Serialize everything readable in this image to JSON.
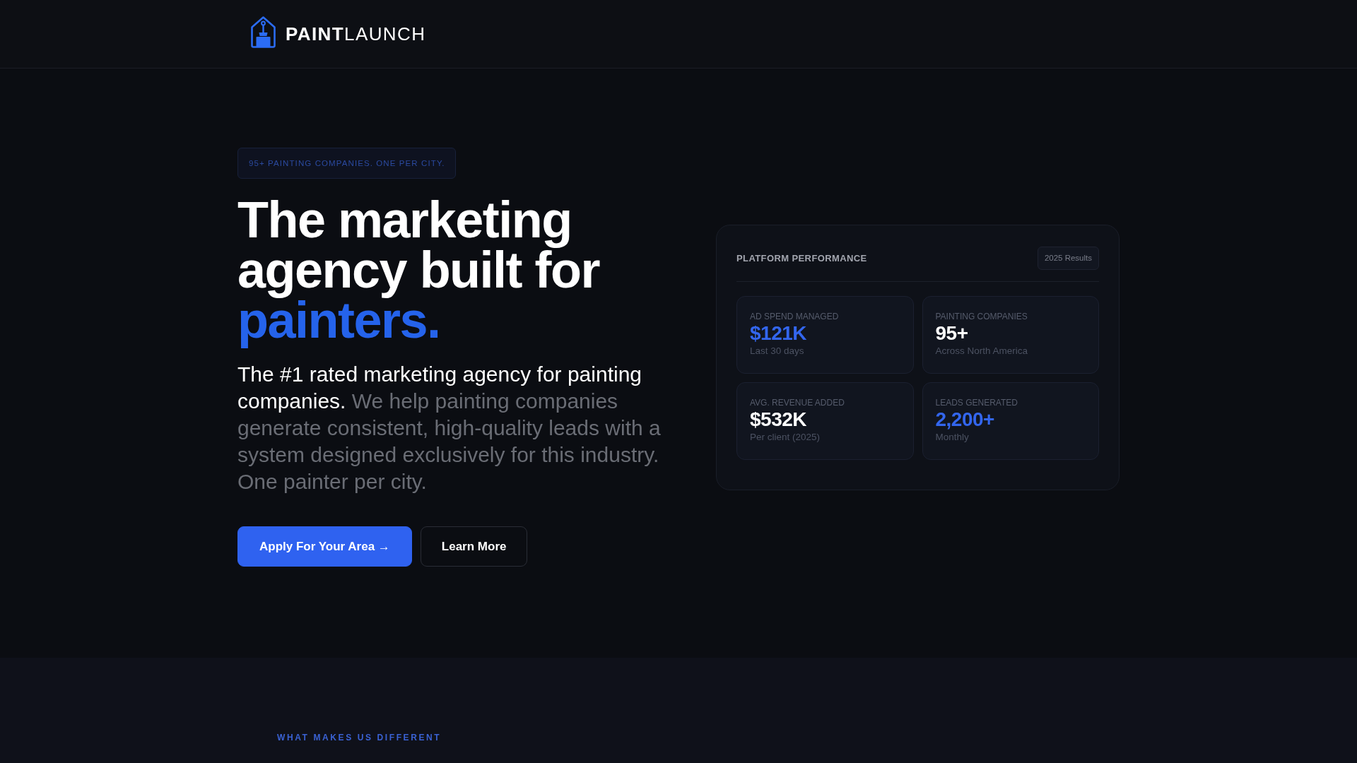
{
  "header": {
    "logo": "**PAINT**LAUNCH"
  },
  "hero": {
    "badge": "95+ PAINTING COMPANIES. ONE PER CITY.",
    "headline": "The marketing agency built for",
    "headline_highlight": "painters.",
    "description": "**The #1 rated marketing agency for painting companies.** We help painting companies generate consistent, high-quality leads with a system designed exclusively for this industry. One painter per city.",
    "buttons": [
      {
        "label": "Apply For Your Area →",
        "kind": "primary"
      },
      {
        "label": "Learn More",
        "kind": "secondary"
      }
    ]
  },
  "performance_card": {
    "title": "PLATFORM PERFORMANCE",
    "badge": "2025 Results",
    "stats": [
      {
        "label": "AD SPEND MANAGED",
        "value": "$121K",
        "note": "Last 30 days",
        "highlight": true
      },
      {
        "label": "PAINTING COMPANIES",
        "value": "95+",
        "note": "Across North America",
        "highlight": false
      },
      {
        "label": "AVG. REVENUE ADDED",
        "value": "$532K",
        "note": "Per client (2025)",
        "highlight": false
      },
      {
        "label": "LEADS GENERATED",
        "value": "2,200+",
        "note": "Monthly",
        "highlight": true
      }
    ]
  },
  "features_section": {
    "eyebrow": "WHAT MAKES US DIFFERENT"
  }
}
